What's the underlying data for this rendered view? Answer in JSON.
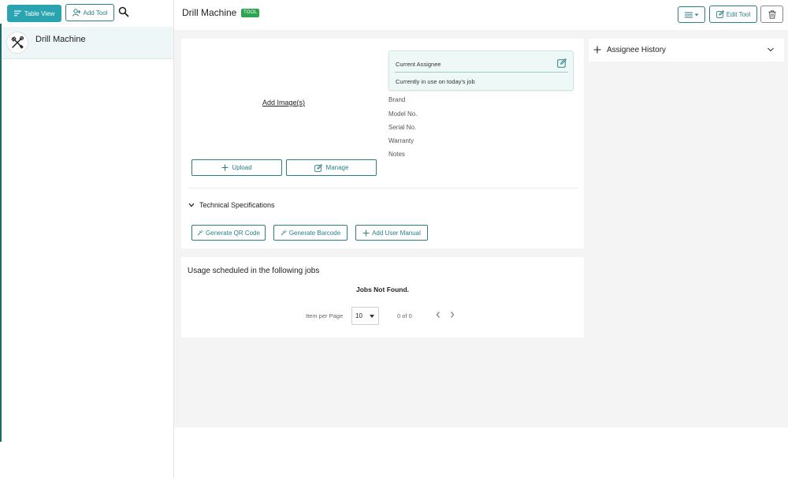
{
  "sidebar": {
    "table_view_label": "Table View",
    "add_tool_label": "Add Tool",
    "items": [
      {
        "name": "Drill Machine",
        "icon": "tools-icon"
      }
    ]
  },
  "header": {
    "title": "Drill Machine",
    "badge": "TOOL",
    "edit_label": "Edit Tool"
  },
  "details": {
    "add_image_label": "Add Image(s)",
    "upload_label": "Upload",
    "manage_label": "Manage",
    "assignee": {
      "title": "Current Assignee",
      "status": "Currently in use on today's job"
    },
    "fields": [
      {
        "label": "Brand"
      },
      {
        "label": "Model No."
      },
      {
        "label": "Serial No."
      },
      {
        "label": "Warranty"
      },
      {
        "label": "Notes"
      }
    ],
    "tech_spec_label": "Technical Specifications",
    "generate_qr_label": "Generate QR Code",
    "generate_barcode_label": "Generate Barcode",
    "add_manual_label": "Add User Manual"
  },
  "jobs": {
    "title": "Usage scheduled in the following jobs",
    "empty_text": "Jobs Not Found.",
    "per_page_label": "Item per Page",
    "per_page_value": "10",
    "range_text": "0 of 0"
  },
  "history": {
    "title": "Assignee History"
  },
  "colors": {
    "accent": "#2aa4b0",
    "outline": "#2b7f86",
    "badge": "#2da44e",
    "sidebar_accent": "#1e6b66"
  }
}
